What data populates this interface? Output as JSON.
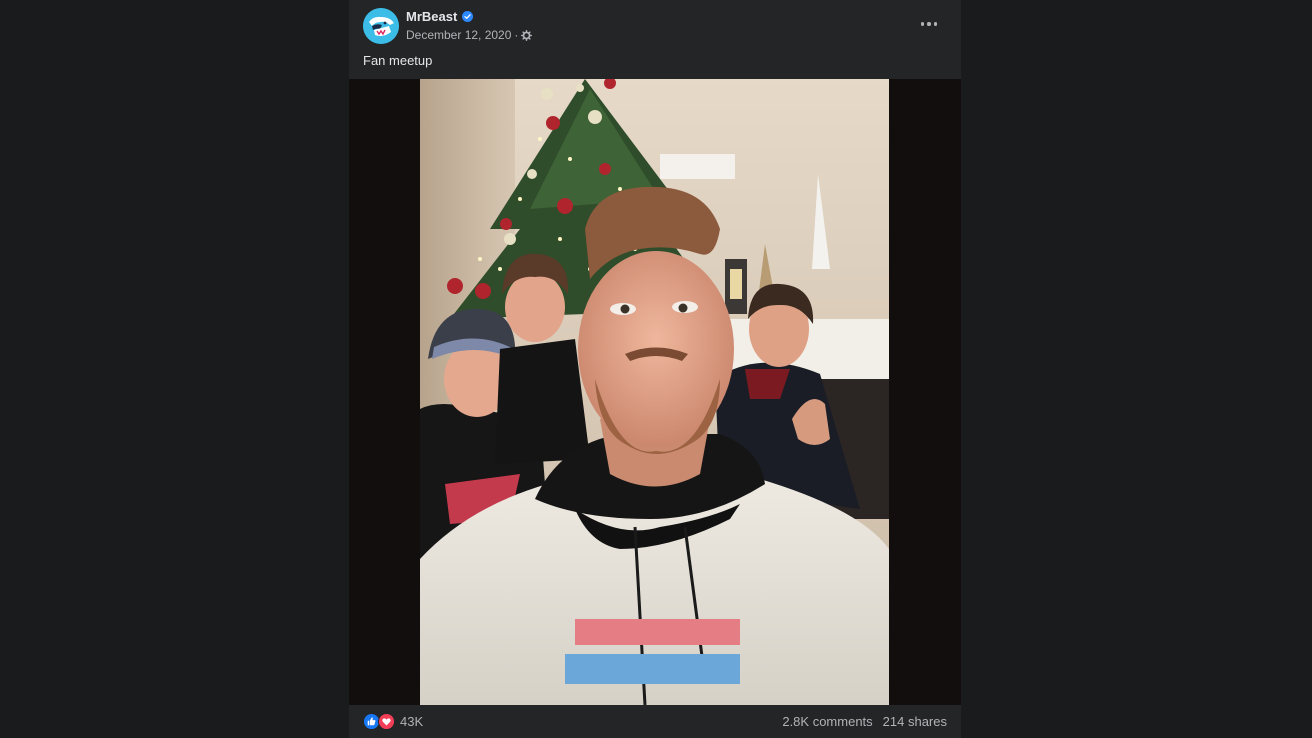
{
  "post": {
    "author": "MrBeast",
    "verified": true,
    "date": "December 12, 2020",
    "separator": "·",
    "audience_icon": "gear-icon",
    "menu_icon": "more-horizontal-icon",
    "caption": "Fan meetup",
    "photo_description_icon": "photo"
  },
  "engagement": {
    "reaction_icons": [
      "like-icon",
      "love-icon"
    ],
    "reaction_count": "43K",
    "comments": "2.8K comments",
    "shares": "214 shares"
  },
  "colors": {
    "page_bg": "#1a1b1d",
    "card_bg": "#242526",
    "text_primary": "#e4e6eb",
    "text_secondary": "#b0b3b8",
    "verified_blue": "#2d88ff",
    "like_blue": "#1877f2",
    "love_red": "#f33e58"
  }
}
